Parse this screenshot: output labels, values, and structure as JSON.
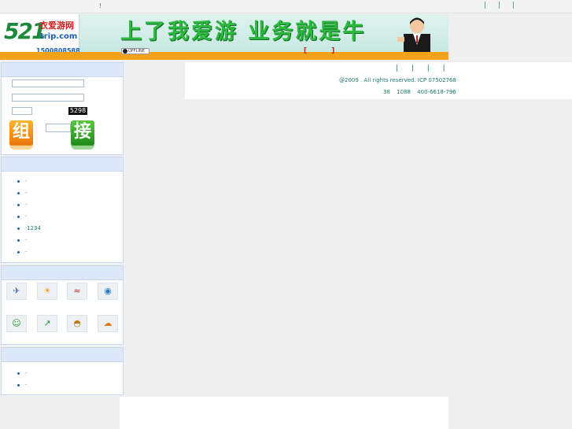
{
  "topbar": {
    "mark": "!",
    "links": "| | |"
  },
  "banner": {
    "logo_number": "521",
    "logo_cn": "衣爱游网",
    "logo_en": "trip.com",
    "phone": "15008085880",
    "slogan": "上了我爱游  业务就是牛",
    "offline": "OFFLINE",
    "bracket": "[ ]"
  },
  "login": {
    "captcha": "5298",
    "btn_left": "组",
    "btn_right": "接"
  },
  "news": {
    "items": [
      {
        "label": "·"
      },
      {
        "label": "·"
      },
      {
        "label": "·"
      },
      {
        "label": "·"
      },
      {
        "label": "·1234"
      },
      {
        "label": "·"
      },
      {
        "label": "·"
      }
    ]
  },
  "tools": {
    "icons": [
      "airplane-icon",
      "weather-icon",
      "train-icon",
      "globe-icon",
      "person-icon",
      "chart-icon",
      "food-icon",
      "cloud-icon"
    ]
  },
  "misc": {
    "items": [
      {
        "label": "·"
      },
      {
        "label": "·"
      }
    ]
  },
  "footer": {
    "links": "| | | |",
    "copyright": "@2009                    . All rights reserved.  ICP 07502768",
    "contact": "38   1088   400-6618-796"
  }
}
